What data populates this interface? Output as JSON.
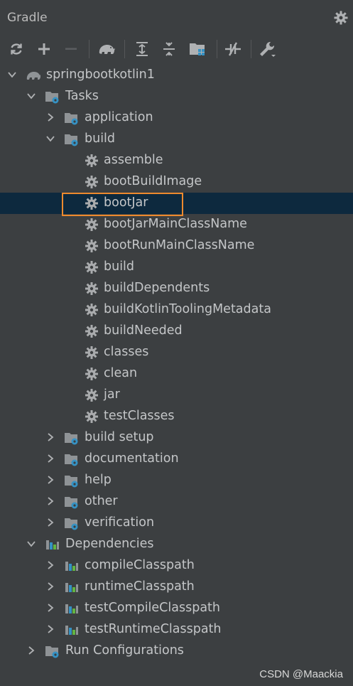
{
  "panel": {
    "title": "Gradle"
  },
  "toolbar": {
    "buttons": [
      "refresh-icon",
      "add-icon",
      "remove-icon",
      "gradle-elephant-icon",
      "expand-all-icon",
      "collapse-all-icon",
      "group-modules-icon",
      "toggle-offline-icon",
      "build-tool-settings-icon"
    ]
  },
  "tree": {
    "project": "springbootkotlin1",
    "tasks": "Tasks",
    "application": "application",
    "build": "build",
    "build_tasks": [
      "assemble",
      "bootBuildImage",
      "bootJar",
      "bootJarMainClassName",
      "bootRunMainClassName",
      "build",
      "buildDependents",
      "buildKotlinToolingMetadata",
      "buildNeeded",
      "classes",
      "clean",
      "jar",
      "testClasses"
    ],
    "task_groups": [
      "build setup",
      "documentation",
      "help",
      "other",
      "verification"
    ],
    "dependencies": "Dependencies",
    "dependency_items": [
      "compileClasspath",
      "runtimeClasspath",
      "testCompileClasspath",
      "testRuntimeClasspath"
    ],
    "run_configurations": "Run Configurations",
    "selected": "bootJar"
  },
  "watermark": "CSDN @Maackia",
  "colors": {
    "selection": "#0d293e",
    "highlight_border": "#ed8a2e",
    "background": "#3c3f41"
  }
}
